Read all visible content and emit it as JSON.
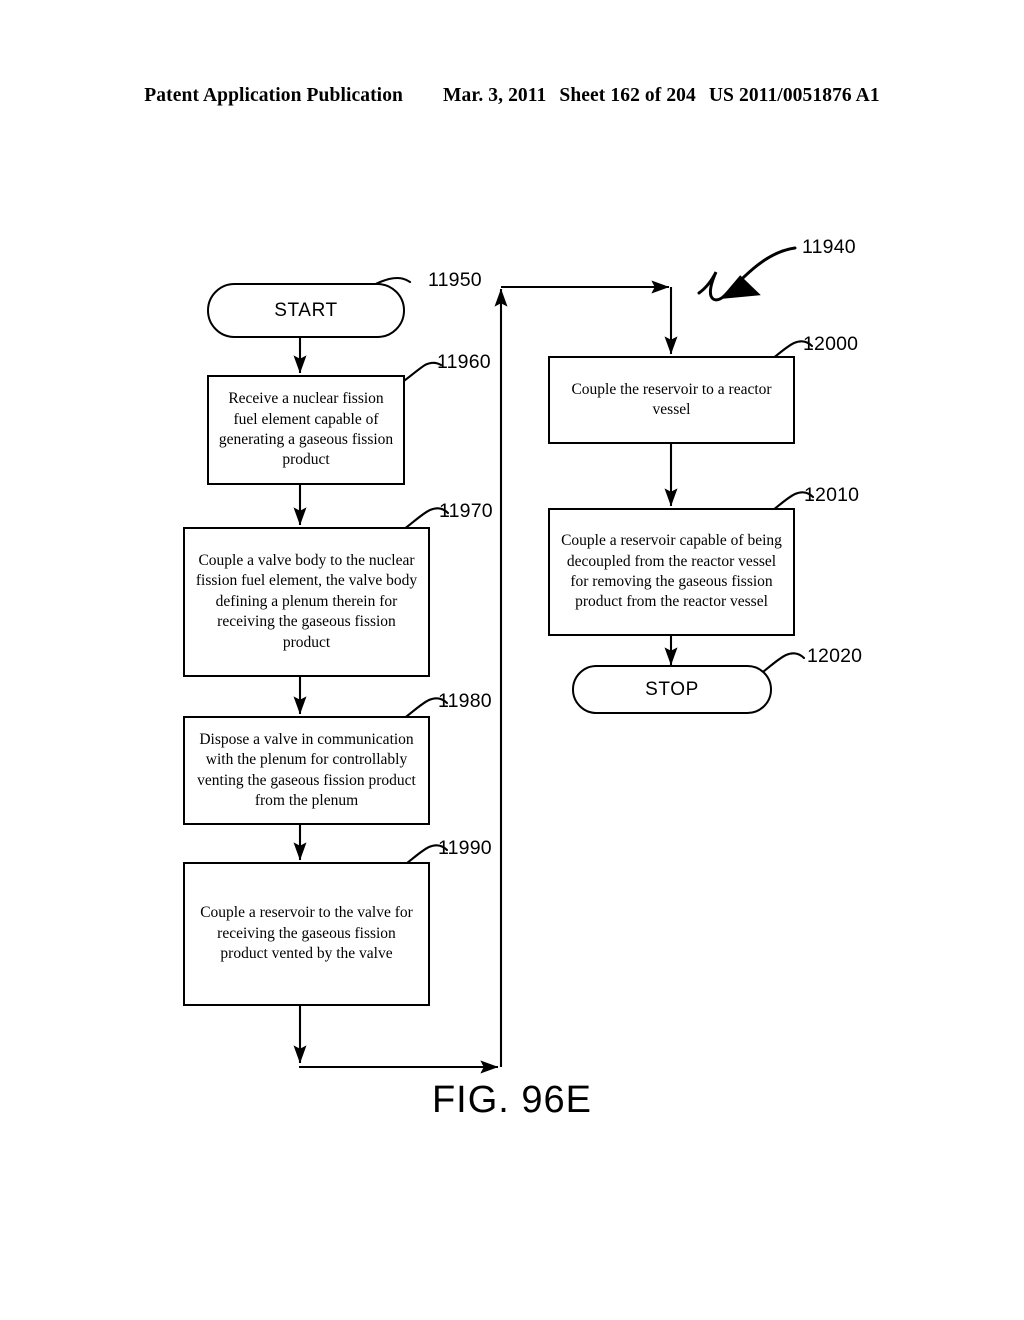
{
  "header": {
    "title": "Patent Application Publication",
    "date": "Mar. 3, 2011",
    "sheet": "Sheet 162 of 204",
    "publication_number": "US 2011/0051876 A1"
  },
  "figure": {
    "caption": "FIG. 96E",
    "diagram_ref": "11940"
  },
  "nodes": [
    {
      "id": "start",
      "ref": "11950",
      "shape": "terminator",
      "text": "START"
    },
    {
      "id": "receive-fuel-element",
      "ref": "11960",
      "shape": "process",
      "text": "Receive a nuclear fission fuel element capable of generating a gaseous fission product"
    },
    {
      "id": "couple-valve-body",
      "ref": "11970",
      "shape": "process",
      "text": "Couple a valve body to the nuclear fission fuel element, the valve body defining a plenum therein for receiving the gaseous fission product"
    },
    {
      "id": "dispose-valve",
      "ref": "11980",
      "shape": "process",
      "text": "Dispose a valve in communication with the plenum for controllably venting the gaseous fission product from the plenum"
    },
    {
      "id": "couple-reservoir-to-valve",
      "ref": "11990",
      "shape": "process",
      "text": "Couple a reservoir to the valve for receiving the gaseous fission product vented by the valve"
    },
    {
      "id": "couple-reservoir-to-vessel",
      "ref": "12000",
      "shape": "process",
      "text": "Couple the reservoir to a reactor vessel"
    },
    {
      "id": "couple-decoupleable-reservoir",
      "ref": "12010",
      "shape": "process",
      "text": "Couple a reservoir capable of being decoupled from the reactor vessel for removing the gaseous fission product from the reactor vessel"
    },
    {
      "id": "stop",
      "ref": "12020",
      "shape": "terminator",
      "text": "STOP"
    }
  ],
  "colors": {
    "ink": "#000000",
    "paper": "#ffffff"
  }
}
